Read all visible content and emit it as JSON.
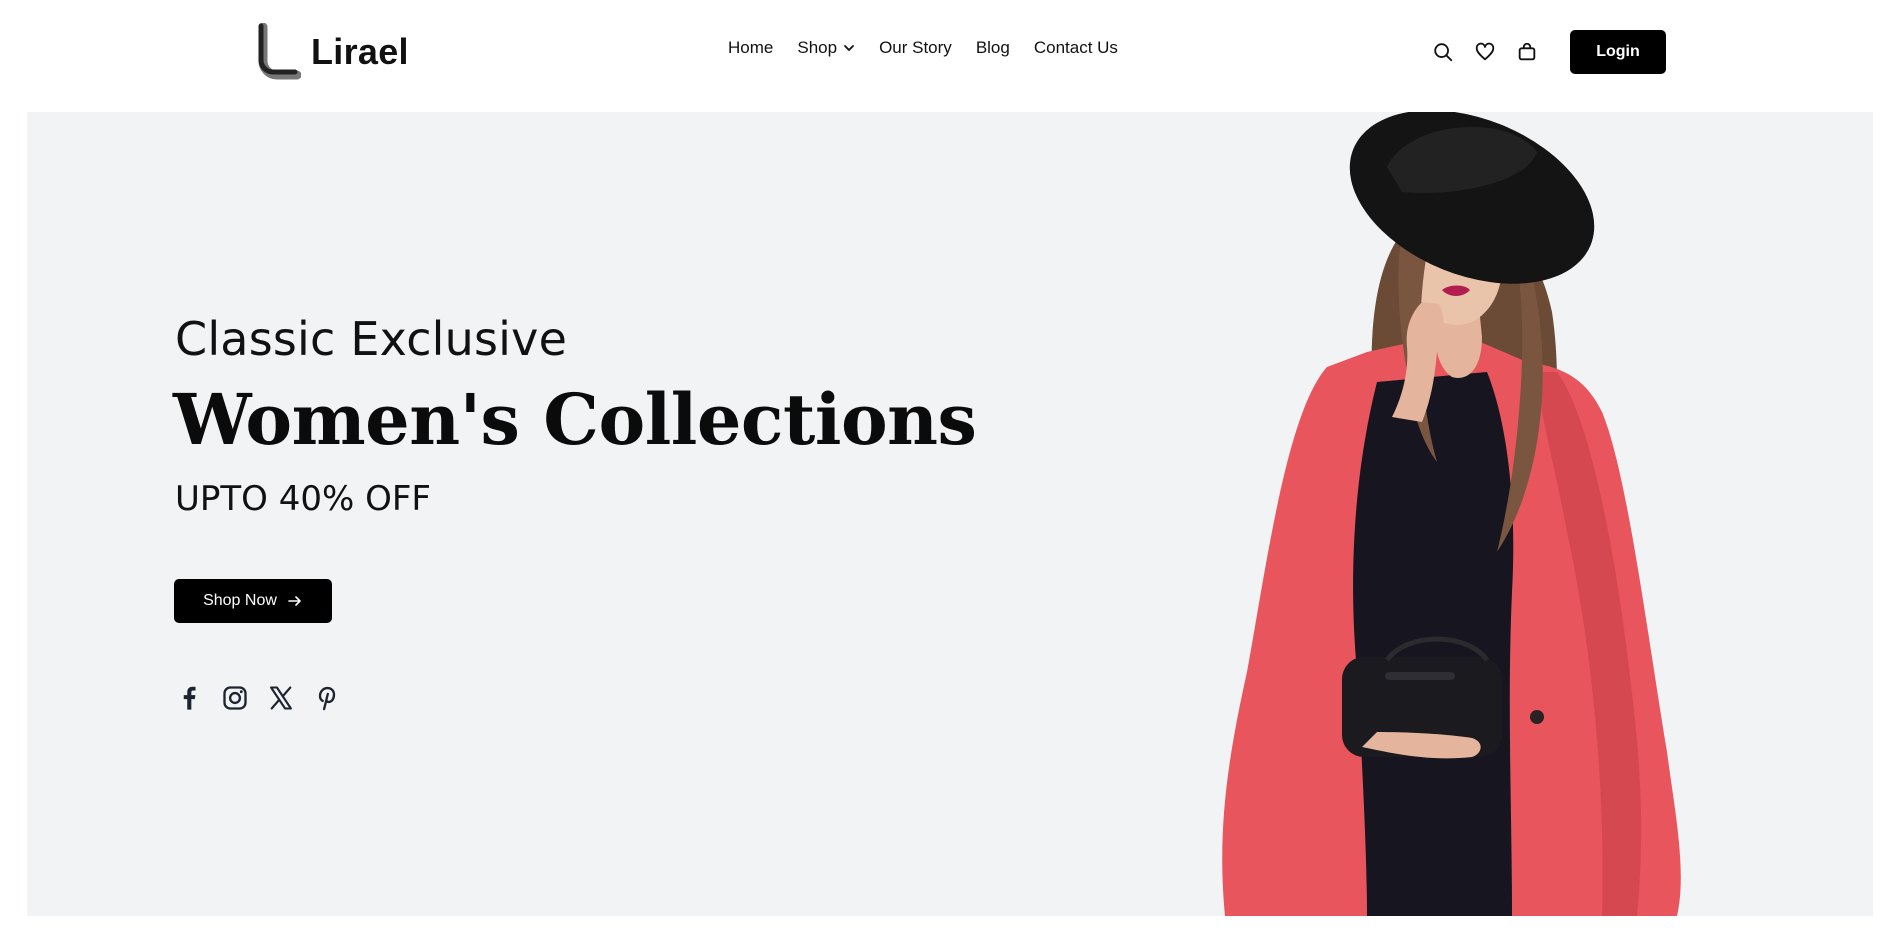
{
  "header": {
    "brand": "Lirael",
    "nav": [
      {
        "label": "Home"
      },
      {
        "label": "Shop",
        "has_dropdown": true
      },
      {
        "label": "Our Story"
      },
      {
        "label": "Blog"
      },
      {
        "label": "Contact Us"
      }
    ],
    "icons": [
      "search-icon",
      "heart-icon",
      "bag-icon"
    ],
    "login_label": "Login"
  },
  "hero": {
    "kicker": "Classic Exclusive",
    "headline": "Women's Collections",
    "offer": "UPTO 40% OFF",
    "cta_label": "Shop Now",
    "socials": [
      "facebook-icon",
      "instagram-icon",
      "x-icon",
      "pinterest-icon"
    ],
    "background": "#f2f3f5",
    "coat_color": "#e8555c"
  }
}
